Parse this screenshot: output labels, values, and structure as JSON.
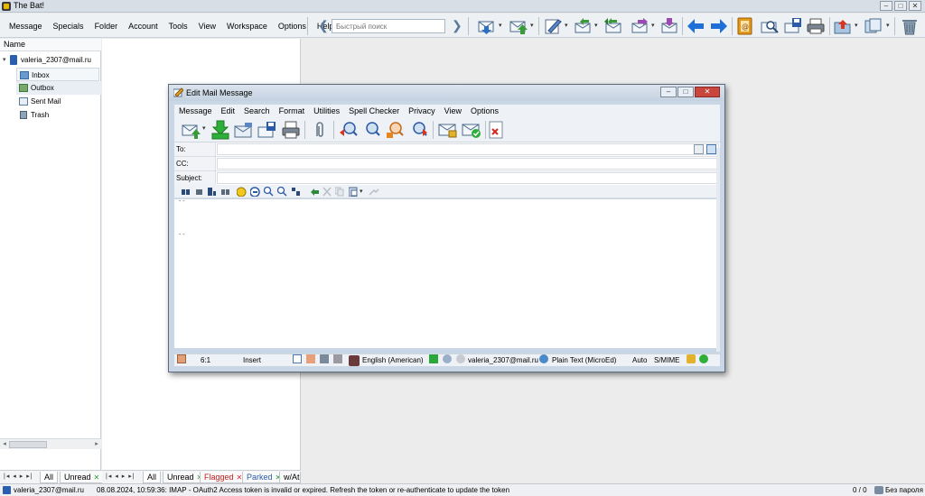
{
  "window": {
    "title": "The Bat!",
    "controls": {
      "minimize": "–",
      "maximize": "□",
      "close": "✕"
    }
  },
  "menubar": {
    "items": [
      "Message",
      "Specials",
      "Folder",
      "Account",
      "Tools",
      "View",
      "Workspace",
      "Options",
      "Help"
    ]
  },
  "quick_search": {
    "placeholder": "Быстрый поиск"
  },
  "toolbar": {
    "icons": [
      "get-new-mail-icon",
      "send-queued-mail-icon",
      "new-message-icon",
      "reply-icon",
      "reply-all-icon",
      "forward-icon",
      "redirect-icon",
      "previous-message-icon",
      "next-message-icon",
      "address-book-icon",
      "find-icon",
      "save-message-icon",
      "print-icon",
      "move-to-folder-icon",
      "copy-to-folder-icon",
      "delete-icon"
    ]
  },
  "folder_pane": {
    "header": "Name",
    "account": "valeria_2307@mail.ru",
    "folders": [
      {
        "label": "Inbox",
        "icon": "inbox-icon"
      },
      {
        "label": "Outbox",
        "icon": "outbox-icon"
      },
      {
        "label": "Sent Mail",
        "icon": "sent-mail-icon"
      },
      {
        "label": "Trash",
        "icon": "trash-icon"
      }
    ],
    "scroll_arrows": {
      "left": "◂",
      "right": "▸"
    }
  },
  "folder_tabs": {
    "nav": "|◂ ◂ ▸ ▸|",
    "tabs": [
      {
        "label": "All",
        "active": true
      },
      {
        "label": "Unread",
        "close": "✕",
        "close_color": "green"
      }
    ]
  },
  "list_tabs": {
    "nav": "|◂ ◂ ▸ ▸|",
    "tabs": [
      {
        "label": "All",
        "active": true
      },
      {
        "label": "Unread",
        "close": "✕",
        "close_color": "green"
      },
      {
        "label": "Flagged",
        "close": "✕",
        "close_color": "red"
      },
      {
        "label": "Parked",
        "close": "✕",
        "close_color": "green"
      },
      {
        "label": "w/At"
      }
    ]
  },
  "statusbar": {
    "account": "valeria_2307@mail.ru",
    "log": "08.08.2024, 10:59:36: IMAP  - OAuth2 Access token is invalid or expired. Refresh the token or re-authenticate to update the token",
    "counts": "0 / 0",
    "password": "Без пароля"
  },
  "compose": {
    "title": "Edit Mail Message",
    "controls": {
      "minimize": "–",
      "maximize": "□",
      "close": "✕"
    },
    "menu": [
      "Message",
      "Edit",
      "Search",
      "Format",
      "Utilities",
      "Spell Checker",
      "Privacy",
      "View",
      "Options"
    ],
    "headers": {
      "to_label": "To:",
      "cc_label": "CC:",
      "subject_label": "Subject:",
      "to_value": "",
      "cc_value": "",
      "subject_value": ""
    },
    "body_lines": [
      "-- ",
      "--"
    ],
    "status": {
      "cursor": "6:1",
      "mode": "Insert",
      "language": "English (American)",
      "account": "valeria_2307@mail.ru",
      "format": "Plain Text (MicroEd)",
      "encoding": "Auto",
      "security": "S/MIME"
    }
  }
}
